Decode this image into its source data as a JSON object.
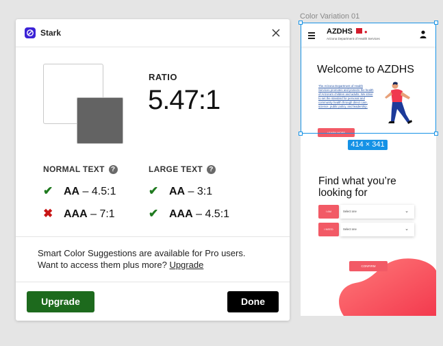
{
  "dialog": {
    "app_title": "Stark",
    "logo_icon": "stark-logo-icon",
    "close_icon": "close-icon",
    "ratio_label": "RATIO",
    "ratio_value": "5.47:1",
    "foreground_color": "#FFFFFF",
    "background_color": "#636363",
    "normal_text": {
      "heading": "NORMAL TEXT",
      "rows": [
        {
          "level": "AA",
          "requirement": " – 4.5:1",
          "status": "pass"
        },
        {
          "level": "AAA",
          "requirement": " – 7:1",
          "status": "fail"
        }
      ]
    },
    "large_text": {
      "heading": "LARGE TEXT",
      "rows": [
        {
          "level": "AA",
          "requirement": " – 3:1",
          "status": "pass"
        },
        {
          "level": "AAA",
          "requirement": " – 4.5:1",
          "status": "pass"
        }
      ]
    },
    "promo": {
      "line1": "Smart Color Suggestions are available for Pro users.",
      "line2": "Want to access them plus more? ",
      "link": "Upgrade"
    },
    "upgrade_button": "Upgrade",
    "done_button": "Done"
  },
  "canvas": {
    "frame_label": "Color Variation 01",
    "selection_size": "414 × 341",
    "site": {
      "brand": "AZDHS",
      "brand_sub": "Arizona Department of Health Services",
      "welcome": "Welcome to AZDHS",
      "body": "The Arizona Department of Health Services promotes and protects the health of Arizona's children and adults. We strive to set the standard for personal and community health through direct care, science, public policy, and leadership.",
      "learn_more": "LEARN MORE",
      "find_heading": "Find what you’re looking for",
      "filters": [
        {
          "tag": "I AM",
          "placeholder": "Select one"
        },
        {
          "tag": "I NEED",
          "placeholder": "Select one"
        }
      ],
      "confirm": "CONFIRM"
    }
  },
  "colors": {
    "accent_purple": "#3B22D6",
    "pass_green": "#1F7A1F",
    "fail_red": "#C81515",
    "upgrade_green": "#1D6A1D",
    "selection_blue": "#1592E6",
    "site_coral": "#F25A66"
  }
}
